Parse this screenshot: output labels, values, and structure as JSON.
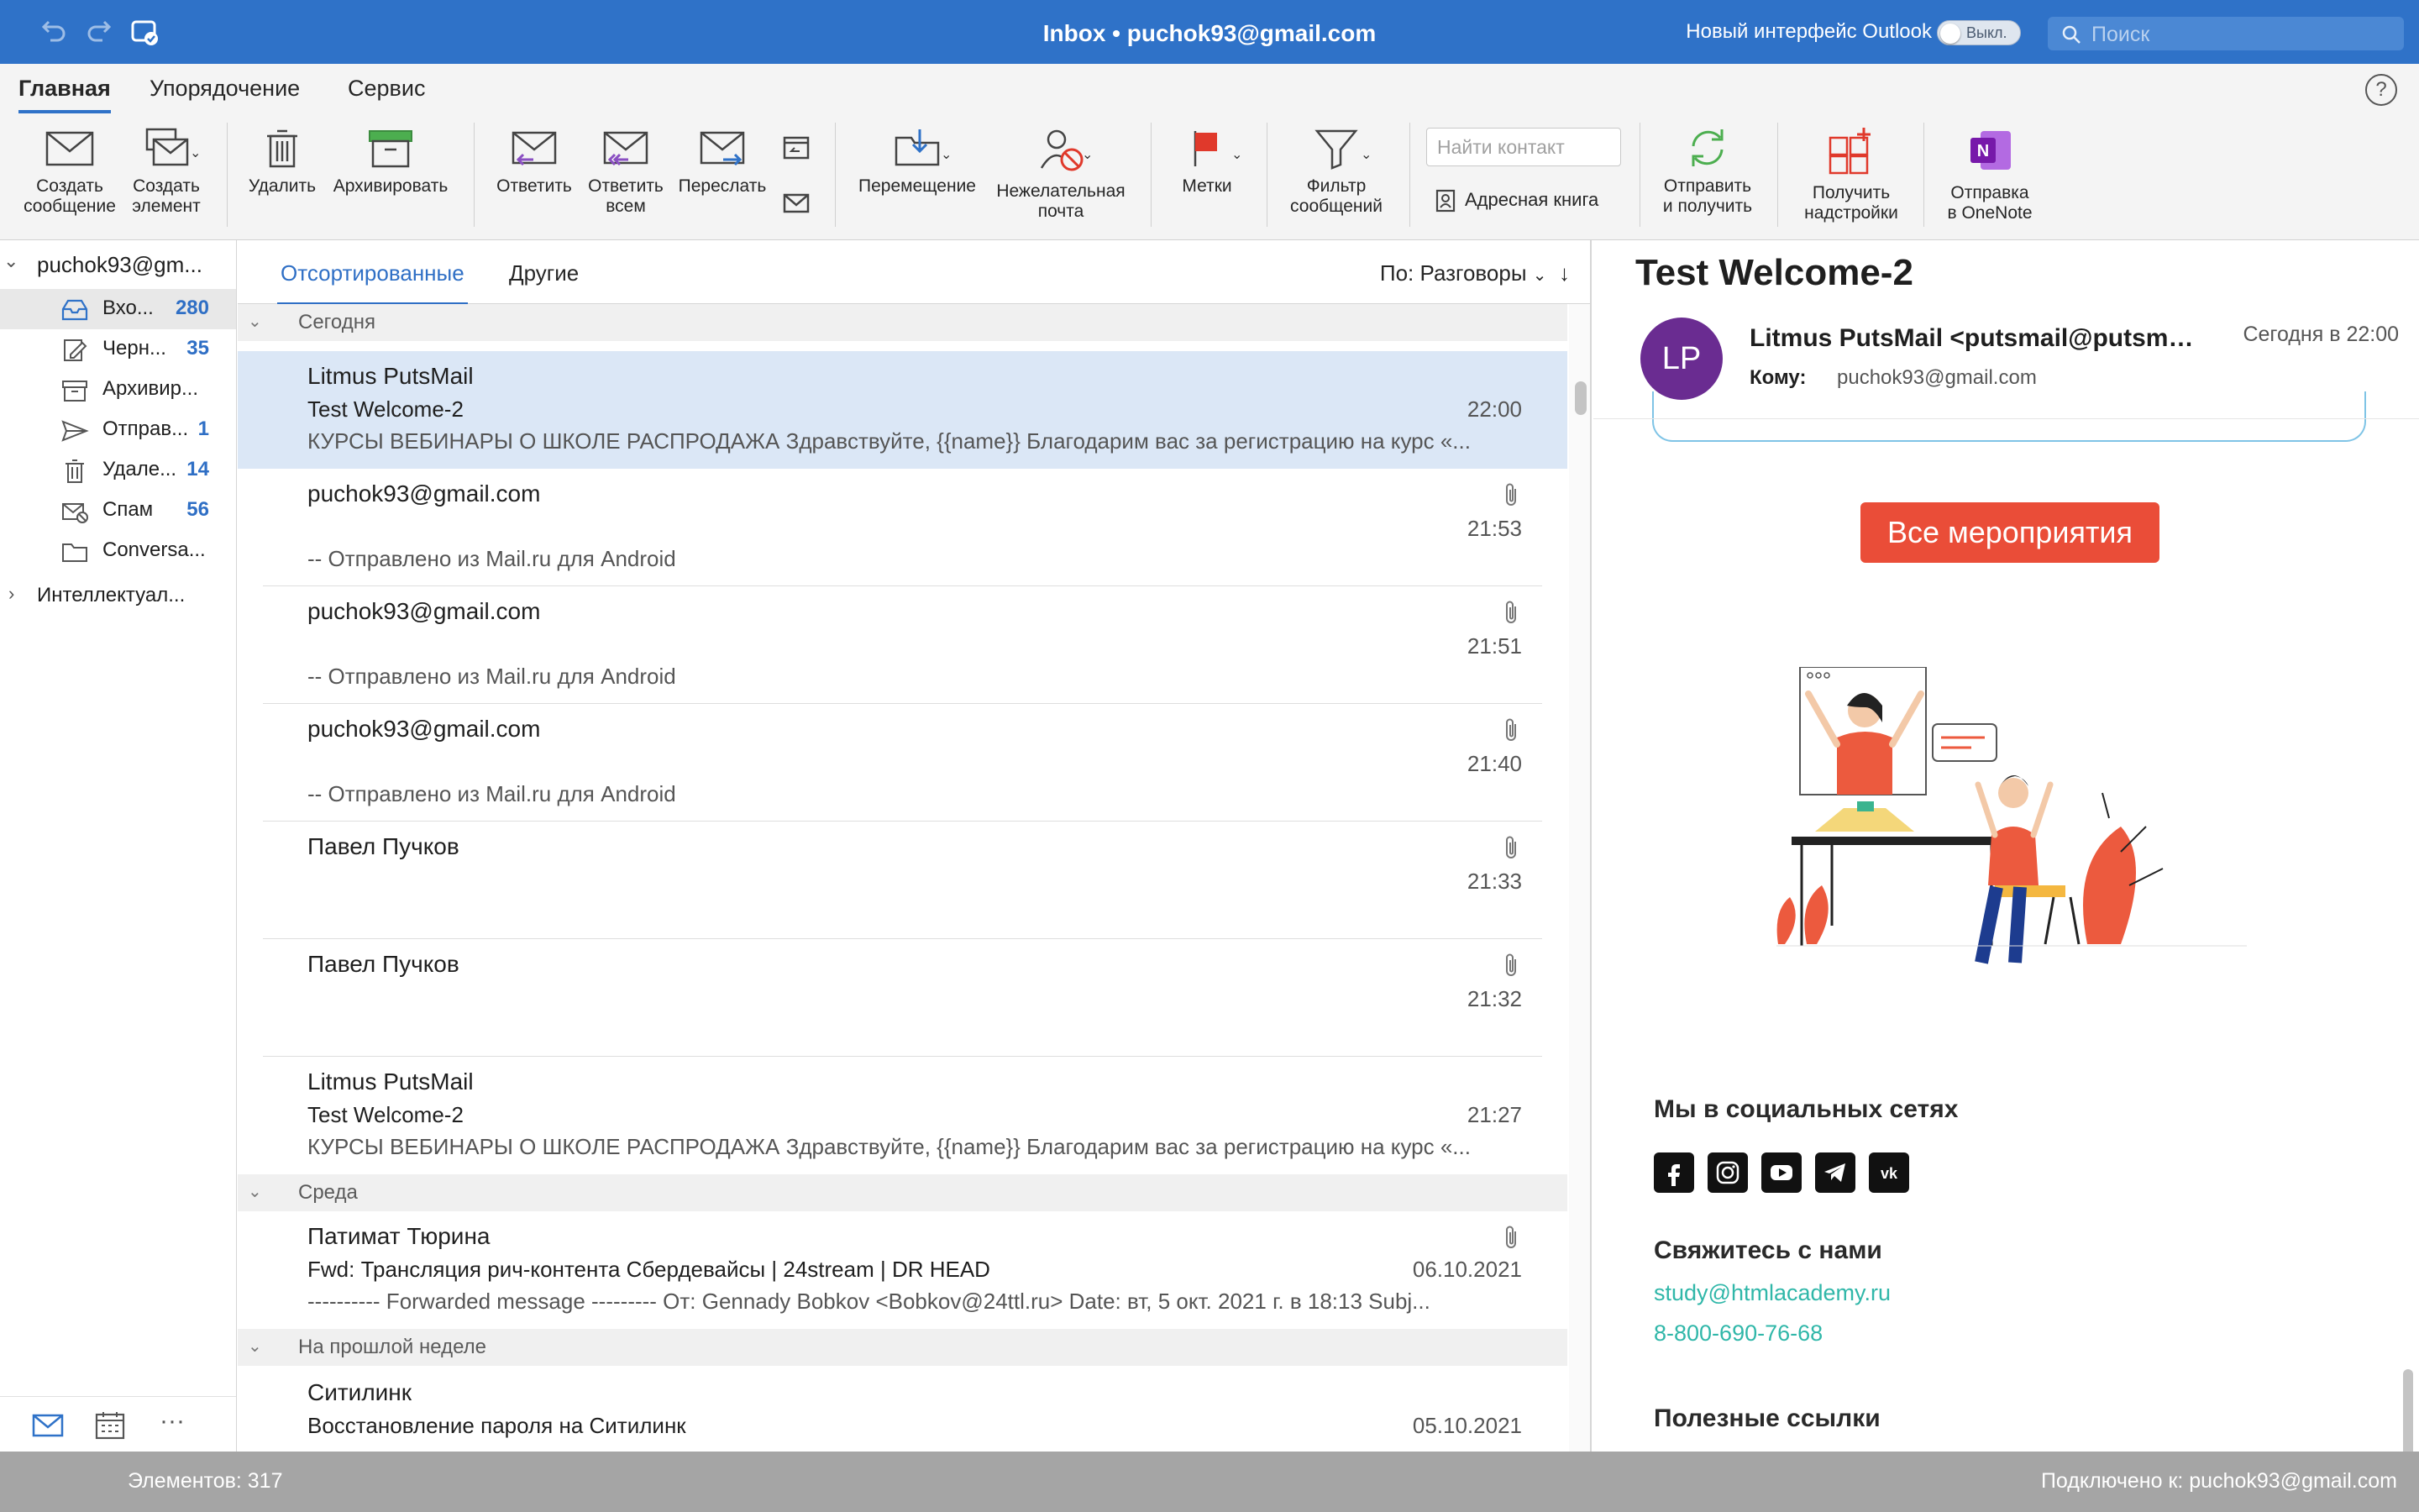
{
  "window": {
    "title": "Inbox • puchok93@gmail.com"
  },
  "titlebar": {
    "new_ui_label": "Новый интерфейс Outlook",
    "toggle_label": "Выкл.",
    "search_placeholder": "Поиск",
    "icons": [
      "undo-icon",
      "redo-icon",
      "sync-icon"
    ]
  },
  "ribbon_tabs": [
    "Главная",
    "Упорядочение",
    "Сервис"
  ],
  "ribbon": {
    "new_message": "Создать\nсообщение",
    "new_item": "Создать\nэлемент",
    "delete": "Удалить",
    "archive": "Архивировать",
    "reply": "Ответить",
    "reply_all": "Ответить\nвсем",
    "forward": "Переслать",
    "move": "Перемещение",
    "junk": "Нежелательная\nпочта",
    "flags": "Метки",
    "filter": "Фильтр\nсообщений",
    "find_contact_placeholder": "Найти контакт",
    "address_book": "Адресная книга",
    "send_receive": "Отправить\nи получить",
    "get_addins": "Получить\nнадстройки",
    "send_onenote": "Отправка\nв OneNote"
  },
  "folders": {
    "account": "puchok93@gm...",
    "items": [
      {
        "name": "Вхо...",
        "count": "280",
        "icon": "inbox-icon"
      },
      {
        "name": "Черн...",
        "count": "35",
        "icon": "drafts-icon"
      },
      {
        "name": "Архивир...",
        "count": "",
        "icon": "archive-icon"
      },
      {
        "name": "Отправ...",
        "count": "1",
        "icon": "sent-icon"
      },
      {
        "name": "Удале...",
        "count": "14",
        "icon": "trash-icon"
      },
      {
        "name": "Спам",
        "count": "56",
        "icon": "spam-icon"
      },
      {
        "name": "Conversa...",
        "count": "",
        "icon": "folder-icon"
      }
    ],
    "smart": "Интеллектуал..."
  },
  "list": {
    "tab_focused": "Отсортированные",
    "tab_other": "Другие",
    "sort": "По: Разговоры",
    "groups": {
      "today": "Сегодня",
      "wednesday": "Среда",
      "last_week": "На прошлой неделе"
    },
    "messages": [
      {
        "sender": "Litmus PutsMail",
        "subject": "Test Welcome-2",
        "time": "22:00",
        "preview": "КУРСЫ ВЕБИНАРЫ О ШКОЛЕ РАСПРОДАЖА Здравствуйте, {{name}} Благодарим вас за регистрацию на курс «..."
      },
      {
        "sender": "puchok93@gmail.com",
        "subject": "",
        "time": "21:53",
        "preview": "-- Отправлено из Mail.ru для Android"
      },
      {
        "sender": "puchok93@gmail.com",
        "subject": "",
        "time": "21:51",
        "preview": "-- Отправлено из Mail.ru для Android"
      },
      {
        "sender": "puchok93@gmail.com",
        "subject": "",
        "time": "21:40",
        "preview": "-- Отправлено из Mail.ru для Android"
      },
      {
        "sender": "Павел Пучков",
        "subject": "",
        "time": "21:33",
        "preview": ""
      },
      {
        "sender": "Павел Пучков",
        "subject": "",
        "time": "21:32",
        "preview": ""
      },
      {
        "sender": "Litmus PutsMail",
        "subject": "Test Welcome-2",
        "time": "21:27",
        "preview": "КУРСЫ ВЕБИНАРЫ О ШКОЛЕ РАСПРОДАЖА Здравствуйте, {{name}} Благодарим вас за регистрацию на курс «..."
      },
      {
        "sender": "Патимат Тюрина",
        "subject": "Fwd: Трансляция рич-контента Сбердевайсы | 24stream | DR HEAD",
        "time": "06.10.2021",
        "preview": "---------- Forwarded message --------- От: Gennady Bobkov <Bobkov@24ttl.ru> Date: вт, 5 окт. 2021 г. в 18:13 Subj..."
      },
      {
        "sender": "Ситилинк",
        "subject": "Восстановление пароля на Ситилинк",
        "time": "05.10.2021",
        "preview": ""
      }
    ]
  },
  "reader": {
    "subject": "Test Welcome-2",
    "avatar_initials": "LP",
    "from": "Litmus PutsMail <putsmail@putsma...",
    "date": "Сегодня в 22:00",
    "to_label": "Кому:",
    "to": "puchok93@gmail.com",
    "events_button": "Все мероприятия",
    "social_heading": "Мы в социальных сетях",
    "contact_heading": "Свяжитесь с нами",
    "email": "study@htmlacademy.ru",
    "phone": "8-800-690-76-68",
    "links_heading": "Полезные ссылки"
  },
  "status": {
    "items": "Элементов: 317",
    "connected": "Подключено к: puchok93@gmail.com"
  },
  "colors": {
    "accent": "#2f72c8",
    "selection": "#dbe7f6",
    "button_red": "#ea4d38",
    "link_teal": "#30b7a9",
    "avatar": "#6a2c91"
  }
}
